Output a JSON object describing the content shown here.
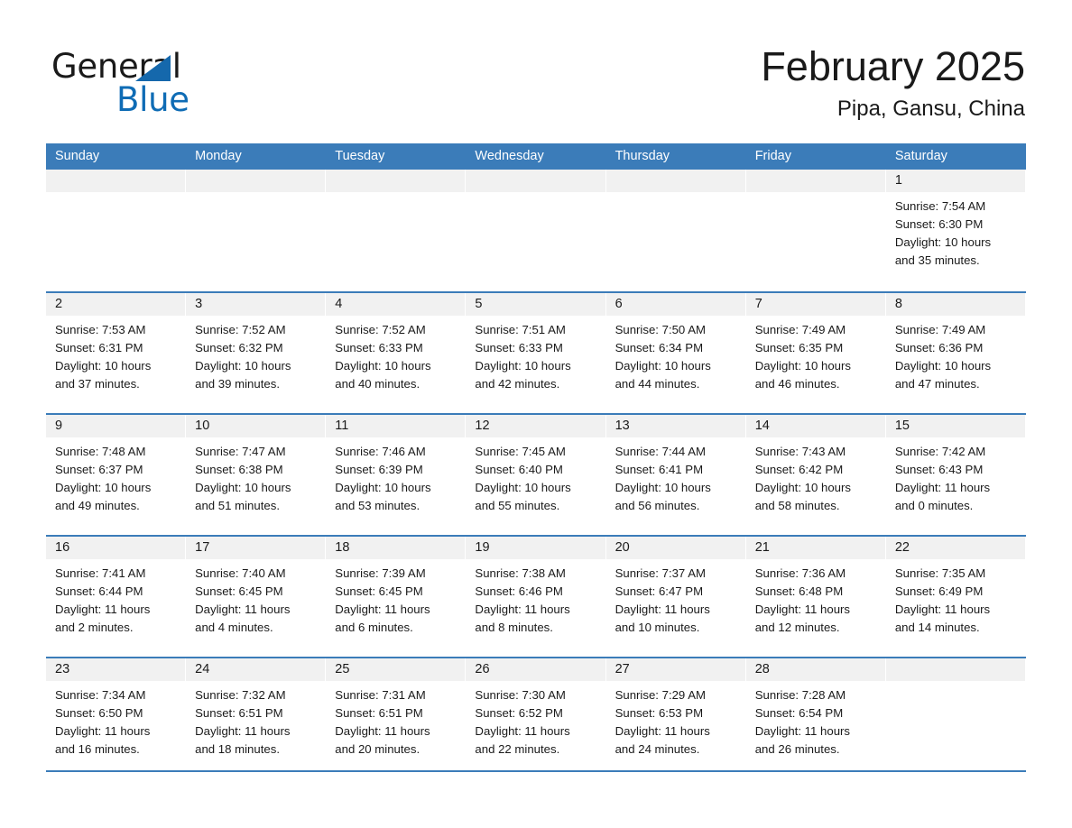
{
  "brand": {
    "name_part1": "General",
    "name_part2": "Blue",
    "triangle_color": "#1568ac",
    "blue_color": "#0f6cb5"
  },
  "header": {
    "month_title": "February 2025",
    "location": "Pipa, Gansu, China"
  },
  "theme": {
    "header_blue": "#3b7cb9",
    "day_band_gray": "#f1f1f1",
    "text_color": "#1a1a1a",
    "page_background": "#ffffff"
  },
  "weekdays": [
    "Sunday",
    "Monday",
    "Tuesday",
    "Wednesday",
    "Thursday",
    "Friday",
    "Saturday"
  ],
  "weeks": [
    [
      {
        "day": "",
        "sunrise": "",
        "sunset": "",
        "daylight1": "",
        "daylight2": ""
      },
      {
        "day": "",
        "sunrise": "",
        "sunset": "",
        "daylight1": "",
        "daylight2": ""
      },
      {
        "day": "",
        "sunrise": "",
        "sunset": "",
        "daylight1": "",
        "daylight2": ""
      },
      {
        "day": "",
        "sunrise": "",
        "sunset": "",
        "daylight1": "",
        "daylight2": ""
      },
      {
        "day": "",
        "sunrise": "",
        "sunset": "",
        "daylight1": "",
        "daylight2": ""
      },
      {
        "day": "",
        "sunrise": "",
        "sunset": "",
        "daylight1": "",
        "daylight2": ""
      },
      {
        "day": "1",
        "sunrise": "Sunrise: 7:54 AM",
        "sunset": "Sunset: 6:30 PM",
        "daylight1": "Daylight: 10 hours",
        "daylight2": "and 35 minutes."
      }
    ],
    [
      {
        "day": "2",
        "sunrise": "Sunrise: 7:53 AM",
        "sunset": "Sunset: 6:31 PM",
        "daylight1": "Daylight: 10 hours",
        "daylight2": "and 37 minutes."
      },
      {
        "day": "3",
        "sunrise": "Sunrise: 7:52 AM",
        "sunset": "Sunset: 6:32 PM",
        "daylight1": "Daylight: 10 hours",
        "daylight2": "and 39 minutes."
      },
      {
        "day": "4",
        "sunrise": "Sunrise: 7:52 AM",
        "sunset": "Sunset: 6:33 PM",
        "daylight1": "Daylight: 10 hours",
        "daylight2": "and 40 minutes."
      },
      {
        "day": "5",
        "sunrise": "Sunrise: 7:51 AM",
        "sunset": "Sunset: 6:33 PM",
        "daylight1": "Daylight: 10 hours",
        "daylight2": "and 42 minutes."
      },
      {
        "day": "6",
        "sunrise": "Sunrise: 7:50 AM",
        "sunset": "Sunset: 6:34 PM",
        "daylight1": "Daylight: 10 hours",
        "daylight2": "and 44 minutes."
      },
      {
        "day": "7",
        "sunrise": "Sunrise: 7:49 AM",
        "sunset": "Sunset: 6:35 PM",
        "daylight1": "Daylight: 10 hours",
        "daylight2": "and 46 minutes."
      },
      {
        "day": "8",
        "sunrise": "Sunrise: 7:49 AM",
        "sunset": "Sunset: 6:36 PM",
        "daylight1": "Daylight: 10 hours",
        "daylight2": "and 47 minutes."
      }
    ],
    [
      {
        "day": "9",
        "sunrise": "Sunrise: 7:48 AM",
        "sunset": "Sunset: 6:37 PM",
        "daylight1": "Daylight: 10 hours",
        "daylight2": "and 49 minutes."
      },
      {
        "day": "10",
        "sunrise": "Sunrise: 7:47 AM",
        "sunset": "Sunset: 6:38 PM",
        "daylight1": "Daylight: 10 hours",
        "daylight2": "and 51 minutes."
      },
      {
        "day": "11",
        "sunrise": "Sunrise: 7:46 AM",
        "sunset": "Sunset: 6:39 PM",
        "daylight1": "Daylight: 10 hours",
        "daylight2": "and 53 minutes."
      },
      {
        "day": "12",
        "sunrise": "Sunrise: 7:45 AM",
        "sunset": "Sunset: 6:40 PM",
        "daylight1": "Daylight: 10 hours",
        "daylight2": "and 55 minutes."
      },
      {
        "day": "13",
        "sunrise": "Sunrise: 7:44 AM",
        "sunset": "Sunset: 6:41 PM",
        "daylight1": "Daylight: 10 hours",
        "daylight2": "and 56 minutes."
      },
      {
        "day": "14",
        "sunrise": "Sunrise: 7:43 AM",
        "sunset": "Sunset: 6:42 PM",
        "daylight1": "Daylight: 10 hours",
        "daylight2": "and 58 minutes."
      },
      {
        "day": "15",
        "sunrise": "Sunrise: 7:42 AM",
        "sunset": "Sunset: 6:43 PM",
        "daylight1": "Daylight: 11 hours",
        "daylight2": "and 0 minutes."
      }
    ],
    [
      {
        "day": "16",
        "sunrise": "Sunrise: 7:41 AM",
        "sunset": "Sunset: 6:44 PM",
        "daylight1": "Daylight: 11 hours",
        "daylight2": "and 2 minutes."
      },
      {
        "day": "17",
        "sunrise": "Sunrise: 7:40 AM",
        "sunset": "Sunset: 6:45 PM",
        "daylight1": "Daylight: 11 hours",
        "daylight2": "and 4 minutes."
      },
      {
        "day": "18",
        "sunrise": "Sunrise: 7:39 AM",
        "sunset": "Sunset: 6:45 PM",
        "daylight1": "Daylight: 11 hours",
        "daylight2": "and 6 minutes."
      },
      {
        "day": "19",
        "sunrise": "Sunrise: 7:38 AM",
        "sunset": "Sunset: 6:46 PM",
        "daylight1": "Daylight: 11 hours",
        "daylight2": "and 8 minutes."
      },
      {
        "day": "20",
        "sunrise": "Sunrise: 7:37 AM",
        "sunset": "Sunset: 6:47 PM",
        "daylight1": "Daylight: 11 hours",
        "daylight2": "and 10 minutes."
      },
      {
        "day": "21",
        "sunrise": "Sunrise: 7:36 AM",
        "sunset": "Sunset: 6:48 PM",
        "daylight1": "Daylight: 11 hours",
        "daylight2": "and 12 minutes."
      },
      {
        "day": "22",
        "sunrise": "Sunrise: 7:35 AM",
        "sunset": "Sunset: 6:49 PM",
        "daylight1": "Daylight: 11 hours",
        "daylight2": "and 14 minutes."
      }
    ],
    [
      {
        "day": "23",
        "sunrise": "Sunrise: 7:34 AM",
        "sunset": "Sunset: 6:50 PM",
        "daylight1": "Daylight: 11 hours",
        "daylight2": "and 16 minutes."
      },
      {
        "day": "24",
        "sunrise": "Sunrise: 7:32 AM",
        "sunset": "Sunset: 6:51 PM",
        "daylight1": "Daylight: 11 hours",
        "daylight2": "and 18 minutes."
      },
      {
        "day": "25",
        "sunrise": "Sunrise: 7:31 AM",
        "sunset": "Sunset: 6:51 PM",
        "daylight1": "Daylight: 11 hours",
        "daylight2": "and 20 minutes."
      },
      {
        "day": "26",
        "sunrise": "Sunrise: 7:30 AM",
        "sunset": "Sunset: 6:52 PM",
        "daylight1": "Daylight: 11 hours",
        "daylight2": "and 22 minutes."
      },
      {
        "day": "27",
        "sunrise": "Sunrise: 7:29 AM",
        "sunset": "Sunset: 6:53 PM",
        "daylight1": "Daylight: 11 hours",
        "daylight2": "and 24 minutes."
      },
      {
        "day": "28",
        "sunrise": "Sunrise: 7:28 AM",
        "sunset": "Sunset: 6:54 PM",
        "daylight1": "Daylight: 11 hours",
        "daylight2": "and 26 minutes."
      },
      {
        "day": "",
        "sunrise": "",
        "sunset": "",
        "daylight1": "",
        "daylight2": ""
      }
    ]
  ]
}
